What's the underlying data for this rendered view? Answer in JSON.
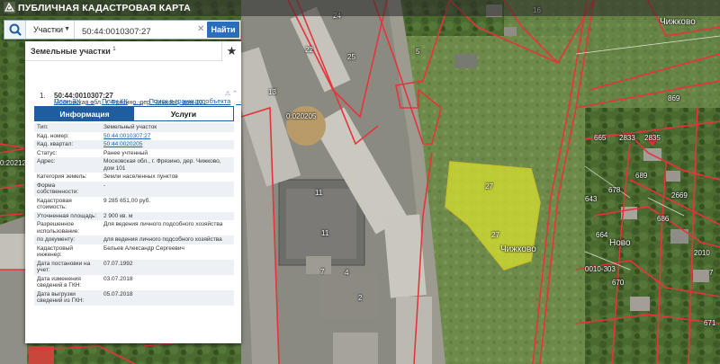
{
  "app": {
    "title": "ПУБЛИЧНАЯ КАДАСТРОВАЯ КАРТА"
  },
  "search": {
    "type_label": "Участки",
    "query": "50:44:0010307:27",
    "find_label": "Найти"
  },
  "panel": {
    "title": "Земельные участки",
    "count": "1",
    "item_number": "1.",
    "cad_number": "50:44:0010307:27",
    "address": "Московская обл., г. Фрязино, дер. Чижково, дом 101",
    "links": {
      "plan_zu": "План ЗУ",
      "plan_kk": "План КК",
      "search_bounds": "Поиск в границах объекта"
    },
    "tabs": {
      "info": "Информация",
      "services": "Услуги"
    },
    "rows": [
      {
        "key": "Тип:",
        "value": "Земельный участок"
      },
      {
        "key": "Кад. номер:",
        "value": "50:44:0010307:27"
      },
      {
        "key": "Кад. квартал:",
        "value": "50:44:0020205"
      },
      {
        "key": "Статус:",
        "value": "Ранее учтенный"
      },
      {
        "key": "Адрес:",
        "value": "Московская обл., г. Фрязино, дер. Чижково, дом 101"
      },
      {
        "key": "Категория земель:",
        "value": "Земли населенных пунктов"
      },
      {
        "key": "Форма собственности:",
        "value": "-"
      },
      {
        "key": "Кадастровая стоимость:",
        "value": "9 285 651,00 руб."
      },
      {
        "key": "Уточненная площадь:",
        "value": "2 900 кв. м"
      },
      {
        "key": "Разрешенное использование:",
        "value": "Для ведения личного подсобного хозяйства"
      },
      {
        "key": "по документу:",
        "value": "для ведения личного подсобного хозяйства"
      },
      {
        "key": "Кадастровый инженер:",
        "value": "Бельев Александр Сергеевич"
      },
      {
        "key": "Дата постановки на учет:",
        "value": "07.07.1992"
      },
      {
        "key": "Дата изменения сведений в ГКН:",
        "value": "03.07.2018"
      },
      {
        "key": "Дата выгрузки сведений из ГКН:",
        "value": "05.07.2018"
      }
    ]
  },
  "map": {
    "labels": {
      "chizhkovo_top": "Чижково",
      "chizhkovo_parcel": "Чижково",
      "parcel_27_top": "27",
      "parcel_27_mid": "27",
      "block_020205": "0:020205",
      "block_20212": "0:20212",
      "block_0303": "0010-303",
      "b13": "13",
      "b11a": "11",
      "b11b": "11",
      "b7": "7",
      "b2": "2",
      "b4": "4",
      "b5": "5",
      "b25": "25",
      "b22": "22",
      "b24": "24",
      "b16": "16",
      "r2833": "2833",
      "r2835": "2835",
      "r665": "665",
      "r643": "643",
      "r664": "664",
      "r670": "670",
      "r2010": "2010",
      "r678": "678",
      "r689": "689",
      "r686": "686",
      "r2669": "2669",
      "r7": "7",
      "r671": "671",
      "r869": "869",
      "nogo": "Ново"
    },
    "colors": {
      "boundary": "#e8323c",
      "selected_parcel": "#d8e030"
    }
  }
}
